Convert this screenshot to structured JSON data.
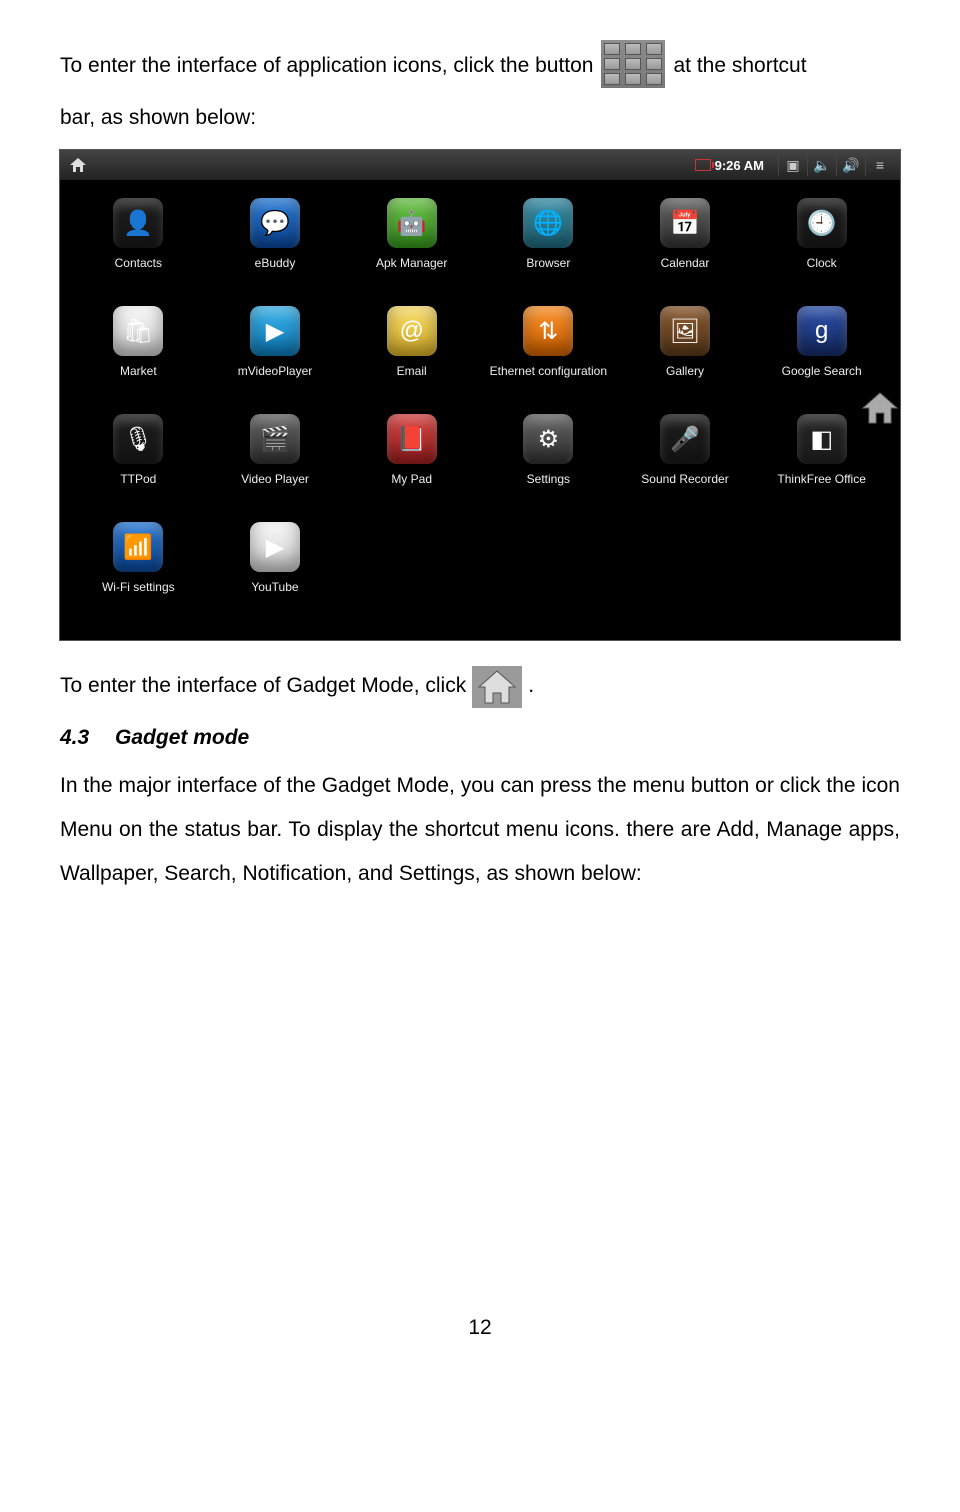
{
  "doc": {
    "line1a": "To enter the interface of application icons, click the button ",
    "line1b": " at the shortcut",
    "line2": "bar, as shown below:",
    "line3a": "To enter the interface of Gadget Mode, click ",
    "line3b": ".",
    "section_num": "4.3",
    "section_title": "Gadget mode",
    "para2": "In the major interface of the Gadget Mode, you can press the menu button or click the icon Menu on the status bar. To display the shortcut menu icons. there are Add, Manage apps, Wallpaper, Search, Notification, and Settings, as shown below:",
    "page_number": "12"
  },
  "status": {
    "time": "9:26 AM"
  },
  "apps": [
    {
      "label": "Contacts",
      "glyph": "👤",
      "cls": "bg-black",
      "name": "app-contacts"
    },
    {
      "label": "eBuddy",
      "glyph": "💬",
      "cls": "bg-blue",
      "name": "app-ebuddy"
    },
    {
      "label": "Apk Manager",
      "glyph": "🤖",
      "cls": "bg-green",
      "name": "app-apk-manager"
    },
    {
      "label": "Browser",
      "glyph": "🌐",
      "cls": "bg-teal",
      "name": "app-browser"
    },
    {
      "label": "Calendar",
      "glyph": "📅",
      "cls": "bg-grey",
      "name": "app-calendar"
    },
    {
      "label": "Clock",
      "glyph": "🕘",
      "cls": "bg-black",
      "name": "app-clock"
    },
    {
      "label": "Market",
      "glyph": "🛍",
      "cls": "bg-white",
      "name": "app-market"
    },
    {
      "label": "mVideoPlayer",
      "glyph": "▶",
      "cls": "bg-lblue",
      "name": "app-mvideoplayer"
    },
    {
      "label": "Email",
      "glyph": "@",
      "cls": "bg-yellow",
      "name": "app-email"
    },
    {
      "label": "Ethernet configuration",
      "glyph": "⇅",
      "cls": "bg-orange",
      "name": "app-ethernet-configuration"
    },
    {
      "label": "Gallery",
      "glyph": "🖼",
      "cls": "bg-brown",
      "name": "app-gallery"
    },
    {
      "label": "Google Search",
      "glyph": "g",
      "cls": "bg-bluedeep",
      "name": "app-google-search"
    },
    {
      "label": "TTPod",
      "glyph": "🎙",
      "cls": "bg-black",
      "name": "app-ttpod"
    },
    {
      "label": "Video Player",
      "glyph": "🎬",
      "cls": "bg-grey",
      "name": "app-video-player"
    },
    {
      "label": "My Pad",
      "glyph": "📕",
      "cls": "bg-red",
      "name": "app-my-pad"
    },
    {
      "label": "Settings",
      "glyph": "⚙",
      "cls": "bg-grey",
      "name": "app-settings"
    },
    {
      "label": "Sound Recorder",
      "glyph": "🎤",
      "cls": "bg-black",
      "name": "app-sound-recorder"
    },
    {
      "label": "ThinkFree Office",
      "glyph": "◧",
      "cls": "bg-multi",
      "name": "app-thinkfree-office"
    },
    {
      "label": "Wi-Fi settings",
      "glyph": "📶",
      "cls": "bg-blue",
      "name": "app-wifi-settings"
    },
    {
      "label": "YouTube",
      "glyph": "▶",
      "cls": "bg-white",
      "name": "app-youtube"
    }
  ]
}
